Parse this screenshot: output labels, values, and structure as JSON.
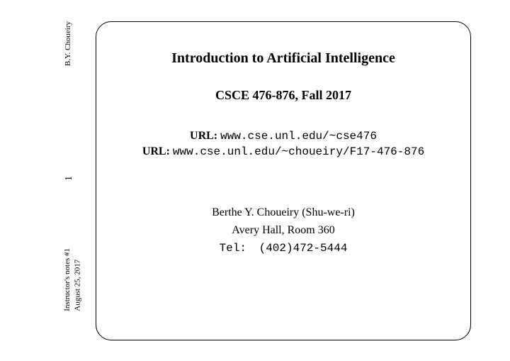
{
  "sidebar": {
    "author": "B.Y. Choueiry",
    "page_number": "1",
    "footer_line1": "Instructor's notes #1",
    "footer_line2": "August 25, 2017"
  },
  "slide": {
    "title": "Introduction to Artificial Intelligence",
    "course": "CSCE 476-876, Fall 2017",
    "url_label": "URL:",
    "url1": "www.cse.unl.edu/~cse476",
    "url2": "www.cse.unl.edu/~choueiry/F17-476-876",
    "instructor_name": "Berthe Y. Choueiry (Shu-we-ri)",
    "office": "Avery Hall, Room 360",
    "tel_label": "Tel:",
    "tel_value": "(402)472-5444"
  }
}
